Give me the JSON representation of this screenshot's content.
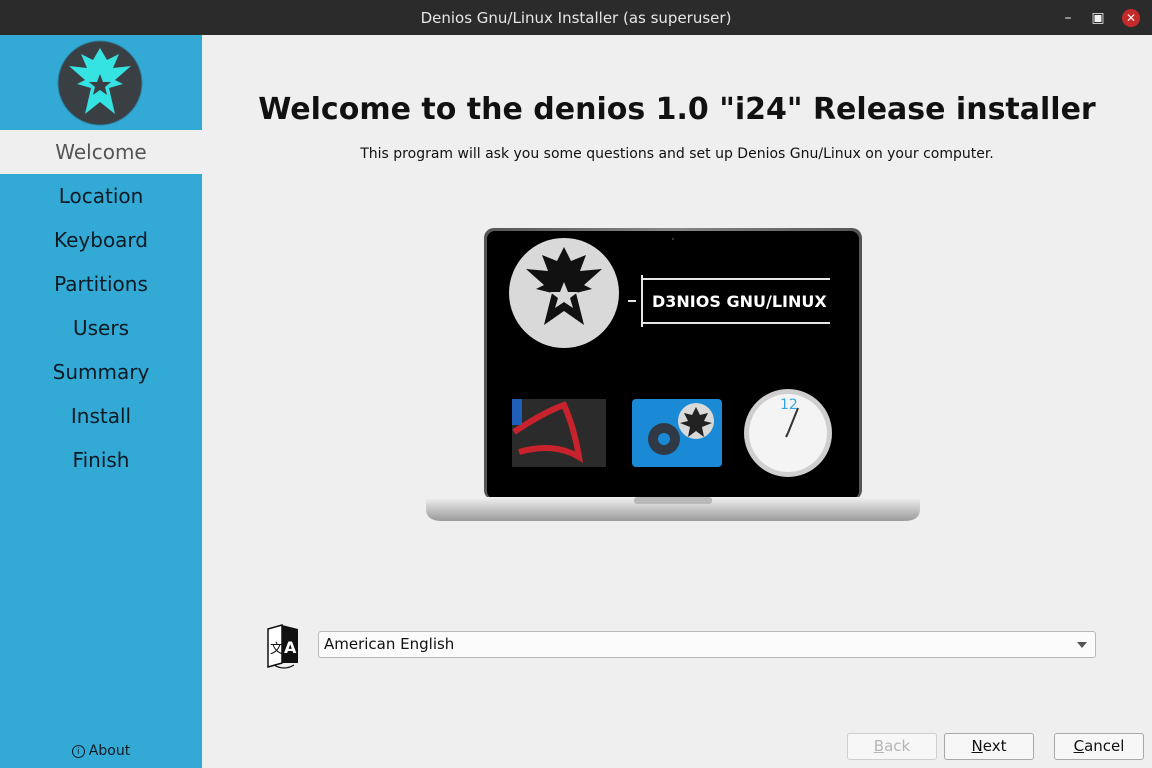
{
  "window": {
    "title": "Denios Gnu/Linux Installer (as superuser)"
  },
  "sidebar": {
    "items": [
      {
        "label": "Welcome",
        "active": true
      },
      {
        "label": "Location"
      },
      {
        "label": "Keyboard"
      },
      {
        "label": "Partitions"
      },
      {
        "label": "Users"
      },
      {
        "label": "Summary"
      },
      {
        "label": "Install"
      },
      {
        "label": "Finish"
      }
    ],
    "about": "About"
  },
  "main": {
    "heading": "Welcome to the denios 1.0 \"i24\" Release installer",
    "subheading": "This program will ask you some questions and set up Denios Gnu/Linux on your computer.",
    "screen_text": "D3NIOS GNU/LINUX",
    "clock_number": "12",
    "language": {
      "selected": "American English"
    }
  },
  "buttons": {
    "back": {
      "first": "B",
      "rest": "ack"
    },
    "next": {
      "first": "N",
      "rest": "ext"
    },
    "cancel": {
      "first": "C",
      "rest": "ancel"
    }
  },
  "colors": {
    "sidebar": "#33a9d5",
    "main_bg": "#efefef",
    "titlebar": "#2b2b2b",
    "close_button": "#c52a2a"
  },
  "icons": [
    "minimize-icon",
    "maximize-icon",
    "close-icon",
    "denios-logo",
    "info-icon",
    "language-icon",
    "dropdown-arrow-icon"
  ]
}
